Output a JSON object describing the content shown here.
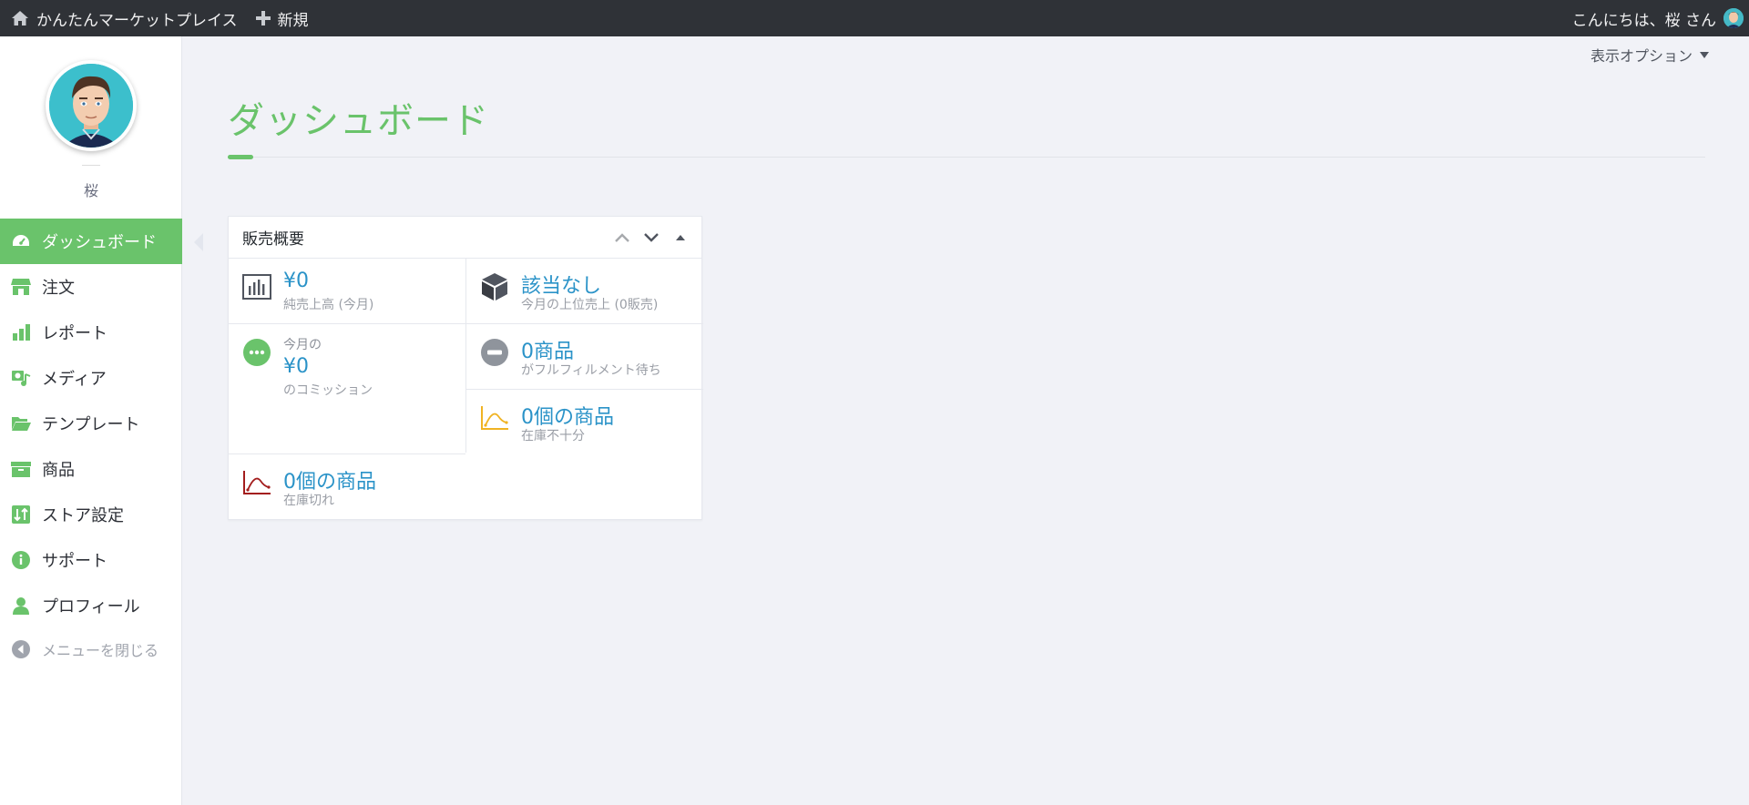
{
  "adminbar": {
    "site_name": "かんたんマーケットプレイス",
    "new_label": "新規",
    "greeting": "こんにちは、桜 さん"
  },
  "sidebar": {
    "user_name": "桜",
    "items": [
      {
        "label": "ダッシュボード",
        "icon": "dashboard-icon"
      },
      {
        "label": "注文",
        "icon": "store-icon"
      },
      {
        "label": "レポート",
        "icon": "bar-chart-icon"
      },
      {
        "label": "メディア",
        "icon": "media-icon"
      },
      {
        "label": "テンプレート",
        "icon": "folder-open-icon"
      },
      {
        "label": "商品",
        "icon": "archive-icon"
      },
      {
        "label": "ストア設定",
        "icon": "sort-settings-icon"
      },
      {
        "label": "サポート",
        "icon": "info-icon"
      },
      {
        "label": "プロフィール",
        "icon": "user-icon"
      }
    ],
    "collapse_label": "メニューを閉じる"
  },
  "main": {
    "screen_options": "表示オプション",
    "page_title": "ダッシュボード"
  },
  "widget": {
    "title": "販売概要",
    "net_sales": {
      "value": "¥0",
      "label": "純売上高 (今月)"
    },
    "top_seller": {
      "value": "該当なし",
      "label": "今月の上位売上 (0販売)"
    },
    "commission": {
      "prefix": "今月の",
      "value": "¥0",
      "label": "のコミッション"
    },
    "awaiting": {
      "value": "0商品",
      "label": "がフルフィルメント待ち"
    },
    "low_stock": {
      "value": "0個の商品",
      "label": "在庫不十分"
    },
    "out_of_stock": {
      "value": "0個の商品",
      "label": "在庫切れ"
    }
  },
  "colors": {
    "accent": "#6ac36b",
    "adminbar": "#2f3237",
    "link": "#2b93c8",
    "low_stock": "#f0b323",
    "out_of_stock": "#a31d1d"
  }
}
